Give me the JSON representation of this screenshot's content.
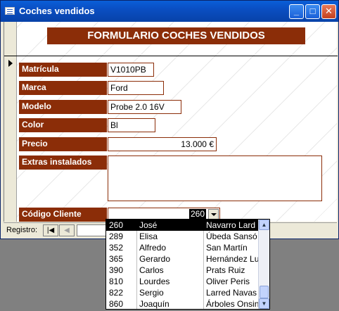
{
  "window": {
    "title": "Coches vendidos",
    "icon": "form-icon"
  },
  "form": {
    "title": "FORMULARIO COCHES VENDIDOS",
    "fields": {
      "matricula": {
        "label": "Matrícula",
        "value": "V1010PB"
      },
      "marca": {
        "label": "Marca",
        "value": "Ford"
      },
      "modelo": {
        "label": "Modelo",
        "value": "Probe 2.0 16V"
      },
      "color": {
        "label": "Color",
        "value": "Bl"
      },
      "precio": {
        "label": "Precio",
        "value": "13.000 €"
      },
      "extras": {
        "label": "Extras instalados",
        "value": ""
      },
      "codigo_cliente": {
        "label": "Código Cliente",
        "value": "260"
      }
    }
  },
  "navigation": {
    "label": "Registro:",
    "first_glyph": "|◀",
    "prev_glyph": "◀"
  },
  "dropdown": {
    "rows": [
      {
        "code": "260",
        "name": "José",
        "surname": "Navarro Lard",
        "selected": true
      },
      {
        "code": "289",
        "name": "Elisa",
        "surname": "Úbeda Sansó"
      },
      {
        "code": "352",
        "name": "Alfredo",
        "surname": "San Martín"
      },
      {
        "code": "365",
        "name": "Gerardo",
        "surname": "Hernández Lu"
      },
      {
        "code": "390",
        "name": "Carlos",
        "surname": "Prats Ruiz"
      },
      {
        "code": "810",
        "name": "Lourdes",
        "surname": "Oliver Peris"
      },
      {
        "code": "822",
        "name": "Sergio",
        "surname": "Larred Navas"
      },
      {
        "code": "860",
        "name": "Joaquín",
        "surname": "Árboles Onsin"
      }
    ]
  },
  "colors": {
    "label_bg": "#8b2d08",
    "titlebar": "#0a4ec2",
    "selection": "#000000"
  }
}
